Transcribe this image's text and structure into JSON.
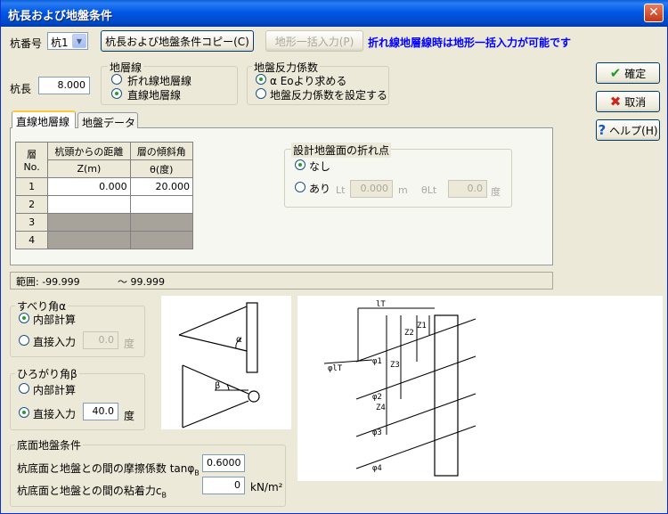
{
  "window": {
    "title": "杭長および地盤条件"
  },
  "toolbar": {
    "pile_no_label": "杭番号",
    "pile_no_value": "杭1",
    "copy_button": "杭長および地盤条件コピー(C)",
    "terrain_button": "地形一括入力(P)",
    "notice": "折れ線地層線時は地形一括入力が可能です"
  },
  "pile_length": {
    "label": "杭長",
    "value": "8.000"
  },
  "layer_line": {
    "title": "地層線",
    "options": [
      "折れ線地層線",
      "直線地層線"
    ],
    "selected": 1
  },
  "reaction": {
    "title": "地盤反力係数",
    "options": [
      "α Eoより求める",
      "地盤反力係数を設定する"
    ],
    "selected": 0
  },
  "actions": {
    "ok": "確定",
    "cancel": "取消",
    "help": "ヘルプ(H)"
  },
  "tabs": [
    "直線地層線",
    "地盤データ"
  ],
  "layer_table": {
    "col_no": "層No.",
    "col_dist": "杭頭からの距離",
    "col_dist_unit": "Z(m)",
    "col_angle": "層の傾斜角",
    "col_angle_unit": "θ(度)",
    "rows": [
      {
        "no": "1",
        "z": "0.000",
        "theta": "20.000"
      },
      {
        "no": "2",
        "z": "",
        "theta": ""
      },
      {
        "no": "3",
        "z": "",
        "theta": ""
      },
      {
        "no": "4",
        "z": "",
        "theta": ""
      }
    ]
  },
  "break_point": {
    "title": "設計地盤面の折れ点",
    "none": "なし",
    "yes": "あり",
    "lt_label": "Lt",
    "lt_value": "0.000",
    "lt_unit": "m",
    "theta_label": "θLt",
    "theta_value": "0.0",
    "theta_unit": "度"
  },
  "range": {
    "label": "範囲: -99.999",
    "to": "～ 99.999"
  },
  "slip_angle": {
    "title": "すべり角α",
    "options": [
      "内部計算",
      "直接入力"
    ],
    "selected": 0,
    "value": "0.0",
    "unit": "度"
  },
  "spread_angle": {
    "title": "ひろがり角β",
    "options": [
      "内部計算",
      "直接入力"
    ],
    "selected": 1,
    "value": "40.0",
    "unit": "度"
  },
  "bottom": {
    "title": "底面地盤条件",
    "friction_label": "杭底面と地盤との間の摩擦係数 tanφ",
    "friction_sub": "B",
    "friction_value": "0.6000",
    "cohesion_label": "杭底面と地盤との間の粘着力c",
    "cohesion_sub": "B",
    "cohesion_value": "0",
    "cohesion_unit": "kN/m²"
  },
  "diagram": {
    "lt": "lT",
    "z1": "Z1",
    "z2": "Z2",
    "z3": "Z3",
    "z4": "Z4",
    "phi_lt": "φlT",
    "phi1": "φ1",
    "phi2": "φ2",
    "phi3": "φ3",
    "phi4": "φ4",
    "alpha": "α",
    "beta": "β"
  }
}
